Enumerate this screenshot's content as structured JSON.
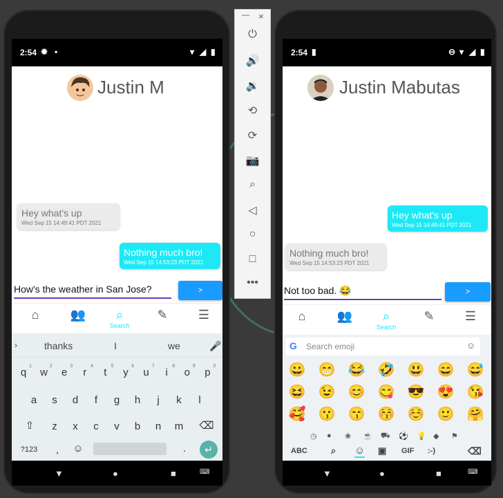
{
  "left_phone": {
    "status": {
      "time": "2:54"
    },
    "contact_name": "Justin M",
    "messages": [
      {
        "text": "Hey what's up",
        "date": "Wed Sep 15 14:49:41 PDT 2021",
        "side": "in"
      },
      {
        "text": "Nothing much bro!",
        "date": "Wed Sep 15 14:53:23 PDT 2021",
        "side": "out"
      }
    ],
    "input_value": "How's the weather in San Jose?",
    "send_label": ">",
    "nav": {
      "search_label": "Search"
    },
    "keyboard": {
      "suggestions": [
        "thanks",
        "I",
        "we"
      ],
      "row1": [
        "q",
        "w",
        "e",
        "r",
        "t",
        "y",
        "u",
        "i",
        "o",
        "p"
      ],
      "row1_nums": [
        "1",
        "2",
        "3",
        "4",
        "5",
        "6",
        "7",
        "8",
        "9",
        "0"
      ],
      "row2": [
        "a",
        "s",
        "d",
        "f",
        "g",
        "h",
        "j",
        "k",
        "l"
      ],
      "row3": [
        "z",
        "x",
        "c",
        "v",
        "b",
        "n",
        "m"
      ],
      "symbols_label": "?123",
      "comma": ",",
      "period": "."
    }
  },
  "right_phone": {
    "status": {
      "time": "2:54"
    },
    "contact_name": "Justin Mabutas",
    "messages": [
      {
        "text": "Hey what's up",
        "date": "Wed Sep 15 14:49:41 PDT 2021",
        "side": "out"
      },
      {
        "text": "Nothing much bro!",
        "date": "Wed Sep 15 14:53:23 PDT 2021",
        "side": "in"
      }
    ],
    "input_value": "Not too bad. 😂",
    "send_label": ">",
    "nav": {
      "search_label": "Search"
    },
    "emoji_keyboard": {
      "search_placeholder": "Search emoji",
      "emojis": [
        "😀",
        "😁",
        "😂",
        "🤣",
        "😃",
        "😄",
        "😅",
        "😆",
        "😉",
        "😊",
        "😋",
        "😎",
        "😍",
        "😘",
        "🥰",
        "😗",
        "😙",
        "😚",
        "☺️",
        "🙂",
        "🤗"
      ],
      "bottom": {
        "abc": "ABC",
        "gif": "GIF",
        "emoticon": ":-)"
      }
    }
  },
  "emulator_toolbar": {
    "minimize": "—",
    "close": "×",
    "icons": [
      "power-icon",
      "volume-up-icon",
      "volume-down-icon",
      "rotate-left-icon",
      "rotate-right-icon",
      "camera-icon",
      "zoom-icon",
      "back-icon",
      "home-icon",
      "overview-icon",
      "more-icon"
    ]
  }
}
